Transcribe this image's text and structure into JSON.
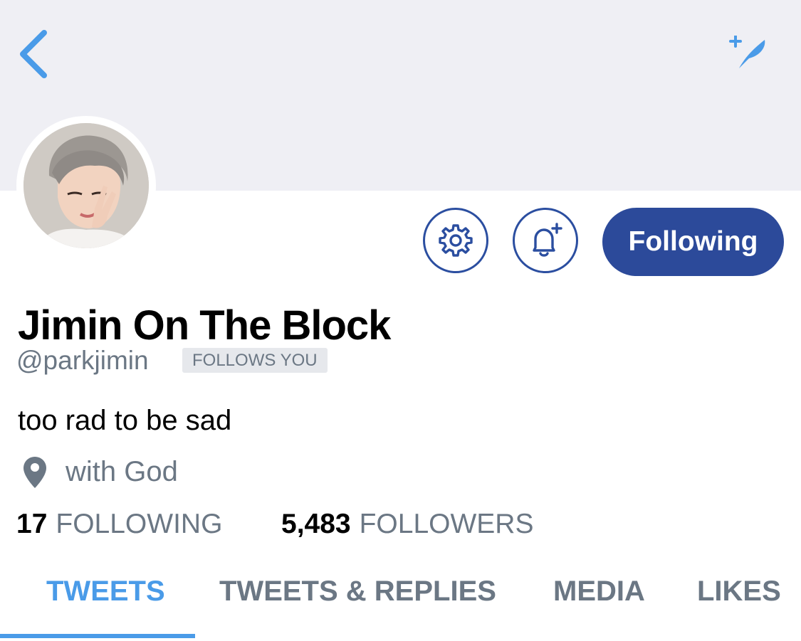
{
  "profile": {
    "display_name": "Jimin On The Block",
    "handle": "@parkjimin",
    "follows_you_badge": "FOLLOWS YOU",
    "bio": "too rad to be sad",
    "location": "with God"
  },
  "actions": {
    "following_label": "Following"
  },
  "stats": {
    "following_count": "17",
    "following_label": "FOLLOWING",
    "followers_count": "5,483",
    "followers_label": "FOLLOWERS"
  },
  "tabs": [
    {
      "label": "TWEETS",
      "active": true
    },
    {
      "label": "TWEETS & REPLIES",
      "active": false
    },
    {
      "label": "MEDIA",
      "active": false
    },
    {
      "label": "LIKES",
      "active": false
    }
  ],
  "icons": {
    "back": "chevron-left-icon",
    "compose": "compose-feather-icon",
    "settings": "gear-icon",
    "notifications": "bell-plus-icon",
    "location": "map-pin-icon"
  },
  "colors": {
    "accent_blue": "#4a9be8",
    "button_navy": "#2c4a9a",
    "header_gray": "#efeff4",
    "secondary_text": "#6b7784"
  }
}
